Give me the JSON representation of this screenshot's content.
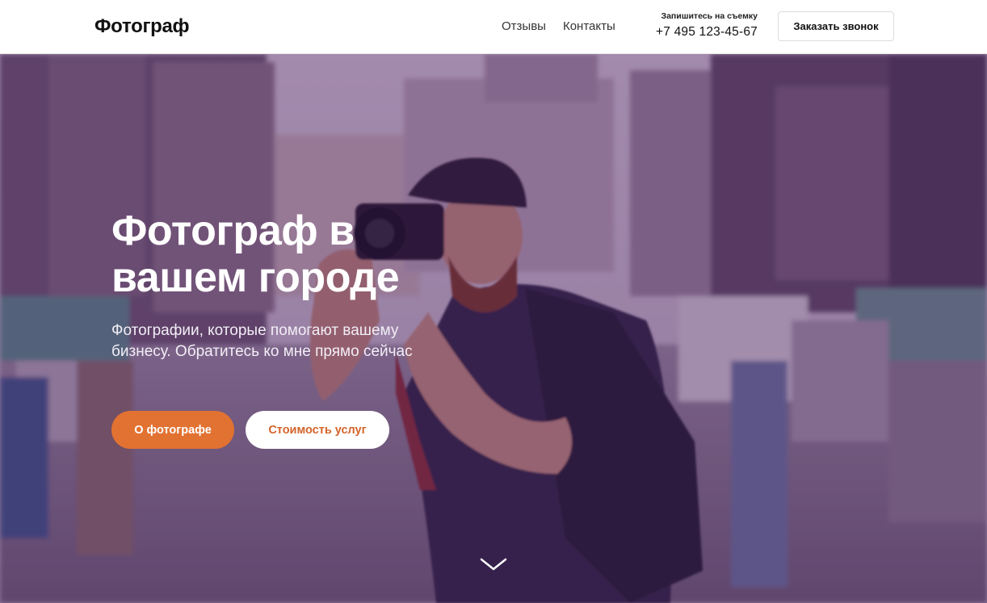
{
  "header": {
    "logo": "Фотограф",
    "nav": [
      "Отзывы",
      "Контакты"
    ],
    "contact_note": "Запишитесь на съемку",
    "phone": "+7 495 123-45-67",
    "call_button": "Заказать звонок"
  },
  "hero": {
    "title": "Фотограф в вашем городе",
    "subtitle": "Фотографии, которые помогают вашему бизнесу. Обратитесь ко мне прямо сейчас",
    "primary_button": "О фотографе",
    "secondary_button": "Стоимость услуг",
    "scroll_icon": "chevron-down-icon",
    "background_image": "photographer-with-camera-on-city-street"
  },
  "colors": {
    "accent": "#e27231",
    "overlay": "#4a1a60",
    "header_bg": "#ffffff"
  }
}
